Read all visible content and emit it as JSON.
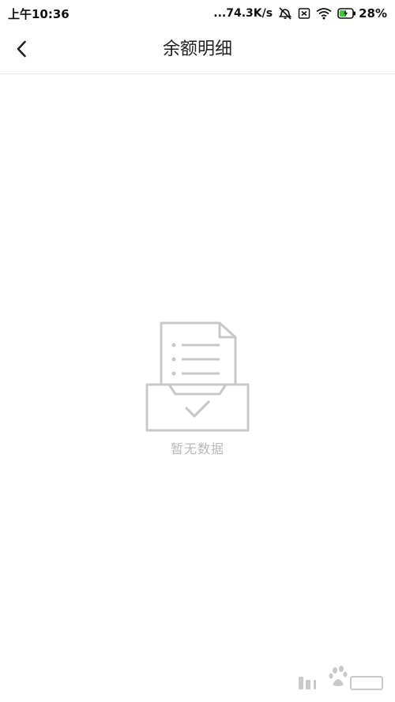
{
  "status_bar": {
    "time": "上午10:36",
    "network_speed": "...74.3K/s",
    "battery_percent": "28%",
    "icons": [
      "alarm-off-icon",
      "sim-no-signal-icon",
      "wifi-icon",
      "battery-charging-icon"
    ]
  },
  "header": {
    "title": "余额明细",
    "back_icon": "chevron-left-icon"
  },
  "empty_state": {
    "icon": "empty-inbox-document-icon",
    "text": "暂无数据"
  },
  "colors": {
    "accent_battery": "#3cc43c",
    "empty_icon": "#c8c8c8",
    "empty_text": "#b8b8b8"
  }
}
